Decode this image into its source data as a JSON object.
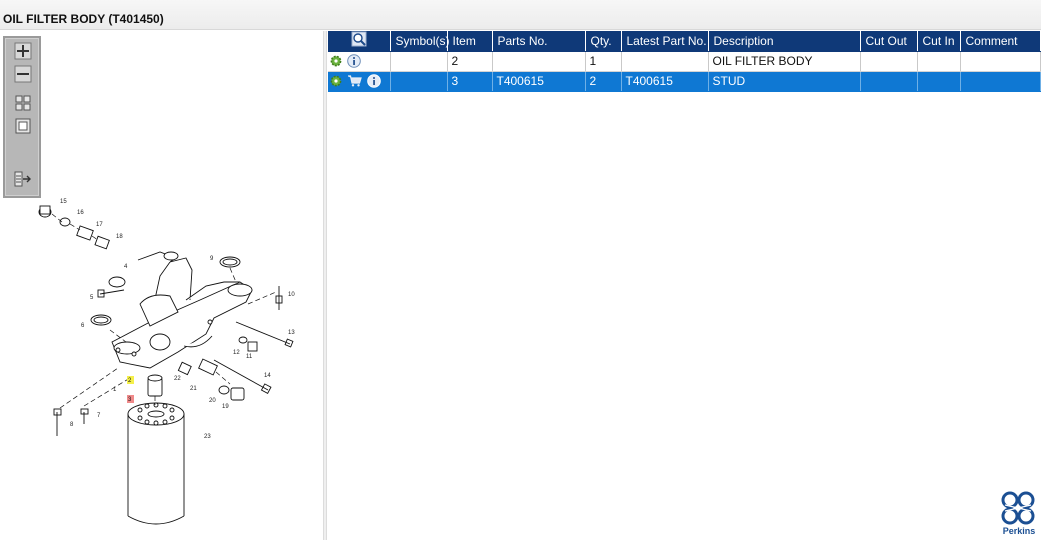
{
  "window": {
    "title": "OIL FILTER BODY (T401450)"
  },
  "toolbar": {
    "buttons": [
      {
        "name": "zoom-in-icon"
      },
      {
        "name": "zoom-out-icon"
      },
      {
        "name": "fit-all-icon"
      },
      {
        "name": "fit-window-icon"
      },
      {
        "name": "export-icon"
      }
    ]
  },
  "diagram": {
    "callouts": [
      "15",
      "16",
      "17",
      "18",
      "4",
      "5",
      "6",
      "9",
      "10",
      "13",
      "12",
      "11",
      "14",
      "22",
      "21",
      "20",
      "19",
      "1",
      "2",
      "3",
      "8",
      "7",
      "23"
    ],
    "highlighted": [
      "2",
      "3"
    ]
  },
  "table": {
    "columns": [
      "",
      "Symbol(s)",
      "Item",
      "Parts No.",
      "Qty.",
      "Latest Part No.",
      "Description",
      "Cut Out",
      "Cut In",
      "Comment"
    ],
    "rows": [
      {
        "icons": [
          "gear-icon",
          "info-icon"
        ],
        "symbols": "",
        "item": "2",
        "part_no": "",
        "qty": "1",
        "latest_part_no": "",
        "description": "OIL FILTER BODY",
        "cut_out": "",
        "cut_in": "",
        "comment": "",
        "selected": false
      },
      {
        "icons": [
          "gear-icon",
          "cart-icon",
          "info-icon"
        ],
        "symbols": "",
        "item": "3",
        "part_no": "T400615",
        "qty": "2",
        "latest_part_no": "T400615",
        "description": "STUD",
        "cut_out": "",
        "cut_in": "",
        "comment": "",
        "selected": true
      }
    ]
  },
  "brand": {
    "logo_text": "Perkins",
    "header_color": "#0f3978",
    "selection_color": "#0f78d3"
  }
}
